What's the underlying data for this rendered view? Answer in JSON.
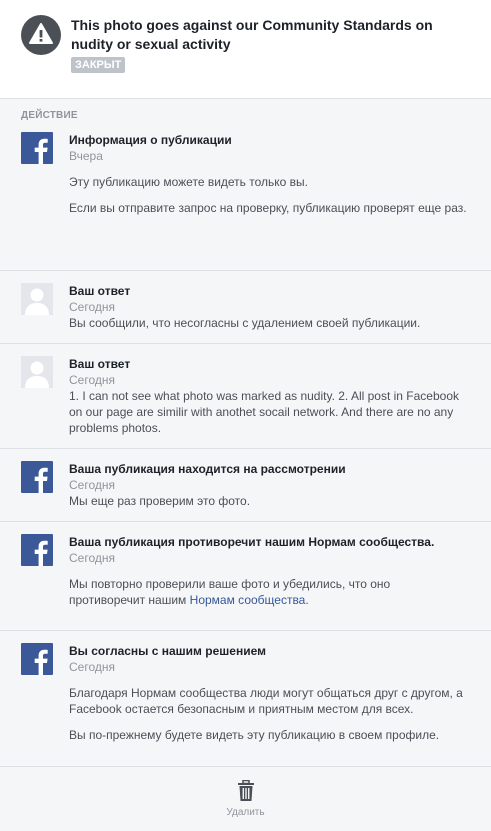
{
  "header": {
    "title": "This photo goes against our Community Standards on nudity or sexual activity",
    "status_badge": "ЗАКРЫТ"
  },
  "section_label": "ДЕЙСТВИЕ",
  "items": [
    {
      "avatar": "facebook",
      "title": "Информация о публикации",
      "time": "Вчера",
      "paragraphs": [
        "Эту публикацию можете видеть только вы.",
        "Если вы отправите запрос на проверку, публикацию проверят еще раз."
      ]
    },
    {
      "avatar": "user",
      "title": "Ваш ответ",
      "time": "Сегодня",
      "paragraphs": [
        "Вы сообщили, что несогласны с удалением своей публикации."
      ]
    },
    {
      "avatar": "user",
      "title": "Ваш ответ",
      "time": "Сегодня",
      "paragraphs": [
        "1. I can not see what photo was marked as nudity. 2. All post in Facebook on our page are similir with anothet socail network. And there are no any problems photos."
      ]
    },
    {
      "avatar": "facebook",
      "title": "Ваша публикация находится на рассмотрении",
      "time": "Сегодня",
      "paragraphs": [
        "Мы еще раз проверим это фото."
      ]
    },
    {
      "avatar": "facebook",
      "title": "Ваша публикация противоречит нашим Нормам сообщества.",
      "time": "Сегодня",
      "paragraph_prefix": "Мы повторно проверили ваше фото и убедились, что оно противоречит нашим ",
      "link_text": "Нормам сообщества",
      "paragraph_suffix": "."
    },
    {
      "avatar": "facebook",
      "title": "Вы согласны с нашим решением",
      "time": "Сегодня",
      "paragraphs": [
        "Благодаря Нормам сообщества люди могут общаться друг с другом, а Facebook остается безопасным и приятным местом для всех.",
        "Вы по-прежнему будете видеть эту публикацию в своем профиле."
      ]
    }
  ],
  "footer": {
    "delete_label": "Удалить"
  },
  "colors": {
    "facebook_blue": "#3b5998",
    "link": "#365899",
    "badge_gray": "#bec3c9",
    "muted_text": "#90949c"
  },
  "icons": {
    "header": "warning-triangle-icon",
    "facebook": "facebook-logo-icon",
    "user": "default-user-avatar-icon",
    "delete": "trash-icon"
  }
}
